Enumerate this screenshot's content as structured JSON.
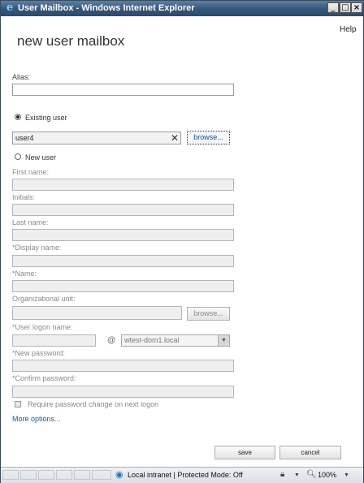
{
  "window": {
    "title": "User Mailbox - Windows Internet Explorer"
  },
  "header": {
    "help": "Help",
    "page_title": "new user mailbox"
  },
  "form": {
    "alias_label": "Alias:",
    "existing_user_label": "Existing user",
    "existing_user_value": "user4",
    "clear_glyph": "✕",
    "browse_label": "browse...",
    "new_user_label": "New user",
    "first_name_label": "First name:",
    "initials_label": "Initials:",
    "last_name_label": "Last name:",
    "display_name_label": "*Display name:",
    "name_label": "*Name:",
    "ou_label": "Organizational unit:",
    "ou_browse_label": "browse...",
    "logon_label": "*User logon name:",
    "at_symbol": "@",
    "domain_value": "wtest-dom1.local",
    "new_password_label": "*New password:",
    "confirm_password_label": "*Confirm password:",
    "require_change_label": "Require password change on next logon",
    "more_options": "More options...",
    "save_label": "save",
    "cancel_label": "cancel"
  },
  "statusbar": {
    "zone": "Local intranet | Protected Mode: Off",
    "zoom": "100%"
  }
}
